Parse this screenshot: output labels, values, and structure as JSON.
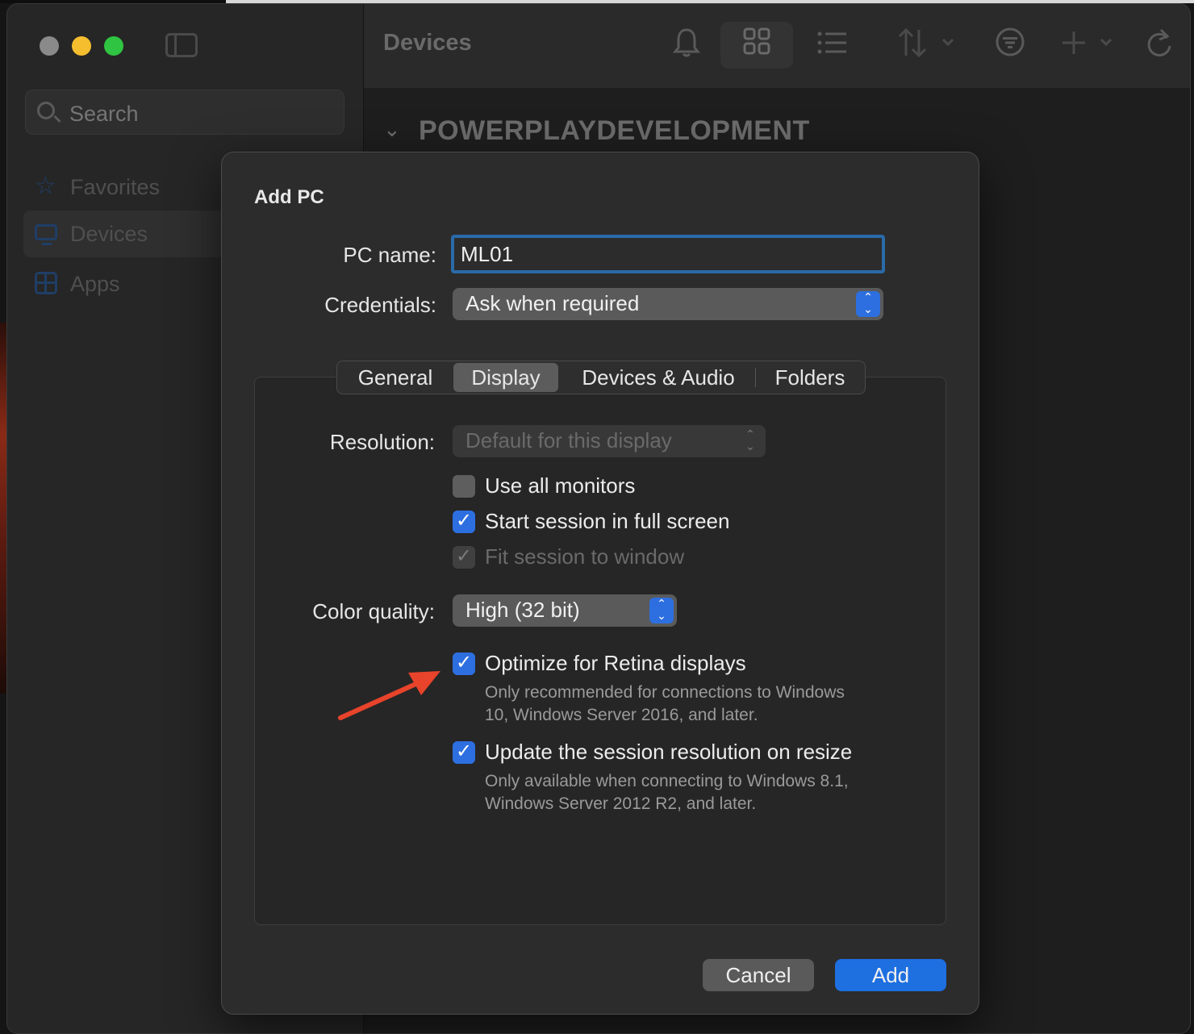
{
  "window": {
    "sidebar": {
      "search_placeholder": "Search",
      "items": [
        {
          "label": "Favorites",
          "icon": "star-icon"
        },
        {
          "label": "Devices",
          "icon": "monitor-icon",
          "active": true
        },
        {
          "label": "Apps",
          "icon": "apps-icon"
        }
      ]
    },
    "toolbar": {
      "title": "Devices",
      "icons": [
        "bell-icon",
        "grid-view-icon",
        "list-view-icon",
        "sort-icon",
        "filter-icon",
        "add-icon",
        "refresh-icon"
      ]
    },
    "content": {
      "group_header": "POWERPLAYDEVELOPMENT"
    }
  },
  "dialog": {
    "title": "Add PC",
    "pc_name_label": "PC name:",
    "pc_name_value": "ML01",
    "credentials_label": "Credentials:",
    "credentials_value": "Ask when required",
    "tabs": [
      "General",
      "Display",
      "Devices & Audio",
      "Folders"
    ],
    "active_tab": "Display",
    "resolution_label": "Resolution:",
    "resolution_value": "Default for this display",
    "checkboxes": {
      "use_all_monitors": {
        "label": "Use all monitors",
        "checked": false
      },
      "full_screen": {
        "label": "Start session in full screen",
        "checked": true
      },
      "fit_window": {
        "label": "Fit session to window",
        "checked": true,
        "disabled": true
      },
      "retina": {
        "label": "Optimize for Retina displays",
        "checked": true,
        "hint_line1": "Only recommended for connections to Windows",
        "hint_line2": "10, Windows Server 2016, and later."
      },
      "resize": {
        "label": "Update the session resolution on resize",
        "checked": true,
        "hint_line1": "Only available when connecting to Windows 8.1,",
        "hint_line2": "Windows Server 2012 R2, and later."
      }
    },
    "color_quality_label": "Color quality:",
    "color_quality_value": "High (32 bit)",
    "cancel_label": "Cancel",
    "add_label": "Add"
  },
  "annotation": {
    "arrow_color": "#e8432b"
  },
  "colors": {
    "accent": "#2d6fe0",
    "focus_ring": "#2a6aa8"
  }
}
